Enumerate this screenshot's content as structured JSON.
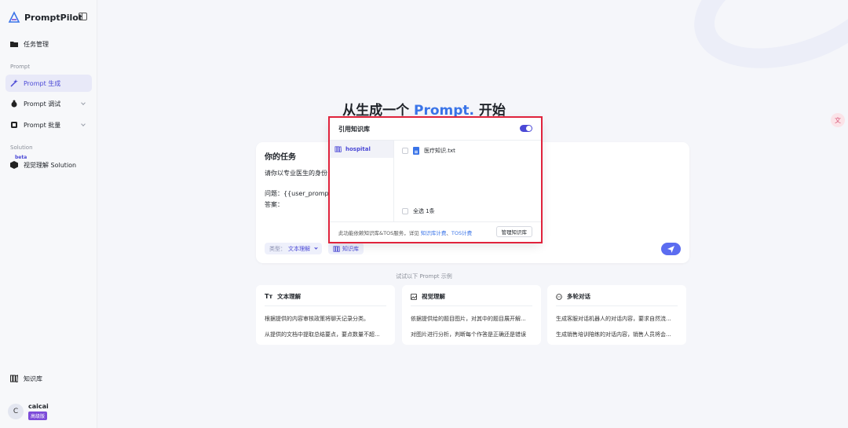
{
  "app": {
    "name": "PromptPilot"
  },
  "sidebar": {
    "tasks": "任务管理",
    "section_prompt": "Prompt",
    "prompt_gen": "Prompt 生成",
    "prompt_debug": "Prompt 调试",
    "prompt_batch": "Prompt 批量",
    "section_solution": "Solution",
    "beta": "beta",
    "visual_solution": "视觉理解 Solution",
    "knowledge": "知识库",
    "user": {
      "initial": "C",
      "name": "caicai",
      "plan": "高级版"
    }
  },
  "main": {
    "hero_pre": "从生成一个 ",
    "hero_hl": "Prompt.",
    "hero_post": " 开始",
    "float_badge": "文",
    "task": {
      "title": "你的任务",
      "line1": "请你以专业医生的身份",
      "line2": "问题：{{user_prompt}}",
      "line3": "答案：",
      "type_label": "类型：",
      "type_value": "文本理解",
      "kb_chip": "知识库"
    },
    "examples_hint": "试试以下 Prompt 示例",
    "examples": [
      {
        "title": "文本理解",
        "lines": [
          "根据提供的内容审核政策将聊天记录分类。",
          "从提供的文档中提取总结要点，要点数量不超..."
        ]
      },
      {
        "title": "视觉理解",
        "lines": [
          "依据提供给的题目图片，对其中的题目展开解...",
          "对图片进行分析，判断每个作答是正确还是错误"
        ]
      },
      {
        "title": "多轮对话",
        "lines": [
          "生成客服对话机器人的对话内容，要求自然流...",
          "生成销售培训陪练的对话内容，销售人员将会..."
        ]
      }
    ]
  },
  "kb_popup": {
    "title": "引用知识库",
    "library": "hospital",
    "file": "医疗知识.txt",
    "select_all": "全选 1条",
    "note_pre": "此功能依赖知识库&TOS服务，详见 ",
    "note_link1": "知识库计费",
    "note_sep": "、",
    "note_link2": "TOS计费",
    "manage_btn": "管理知识库"
  }
}
